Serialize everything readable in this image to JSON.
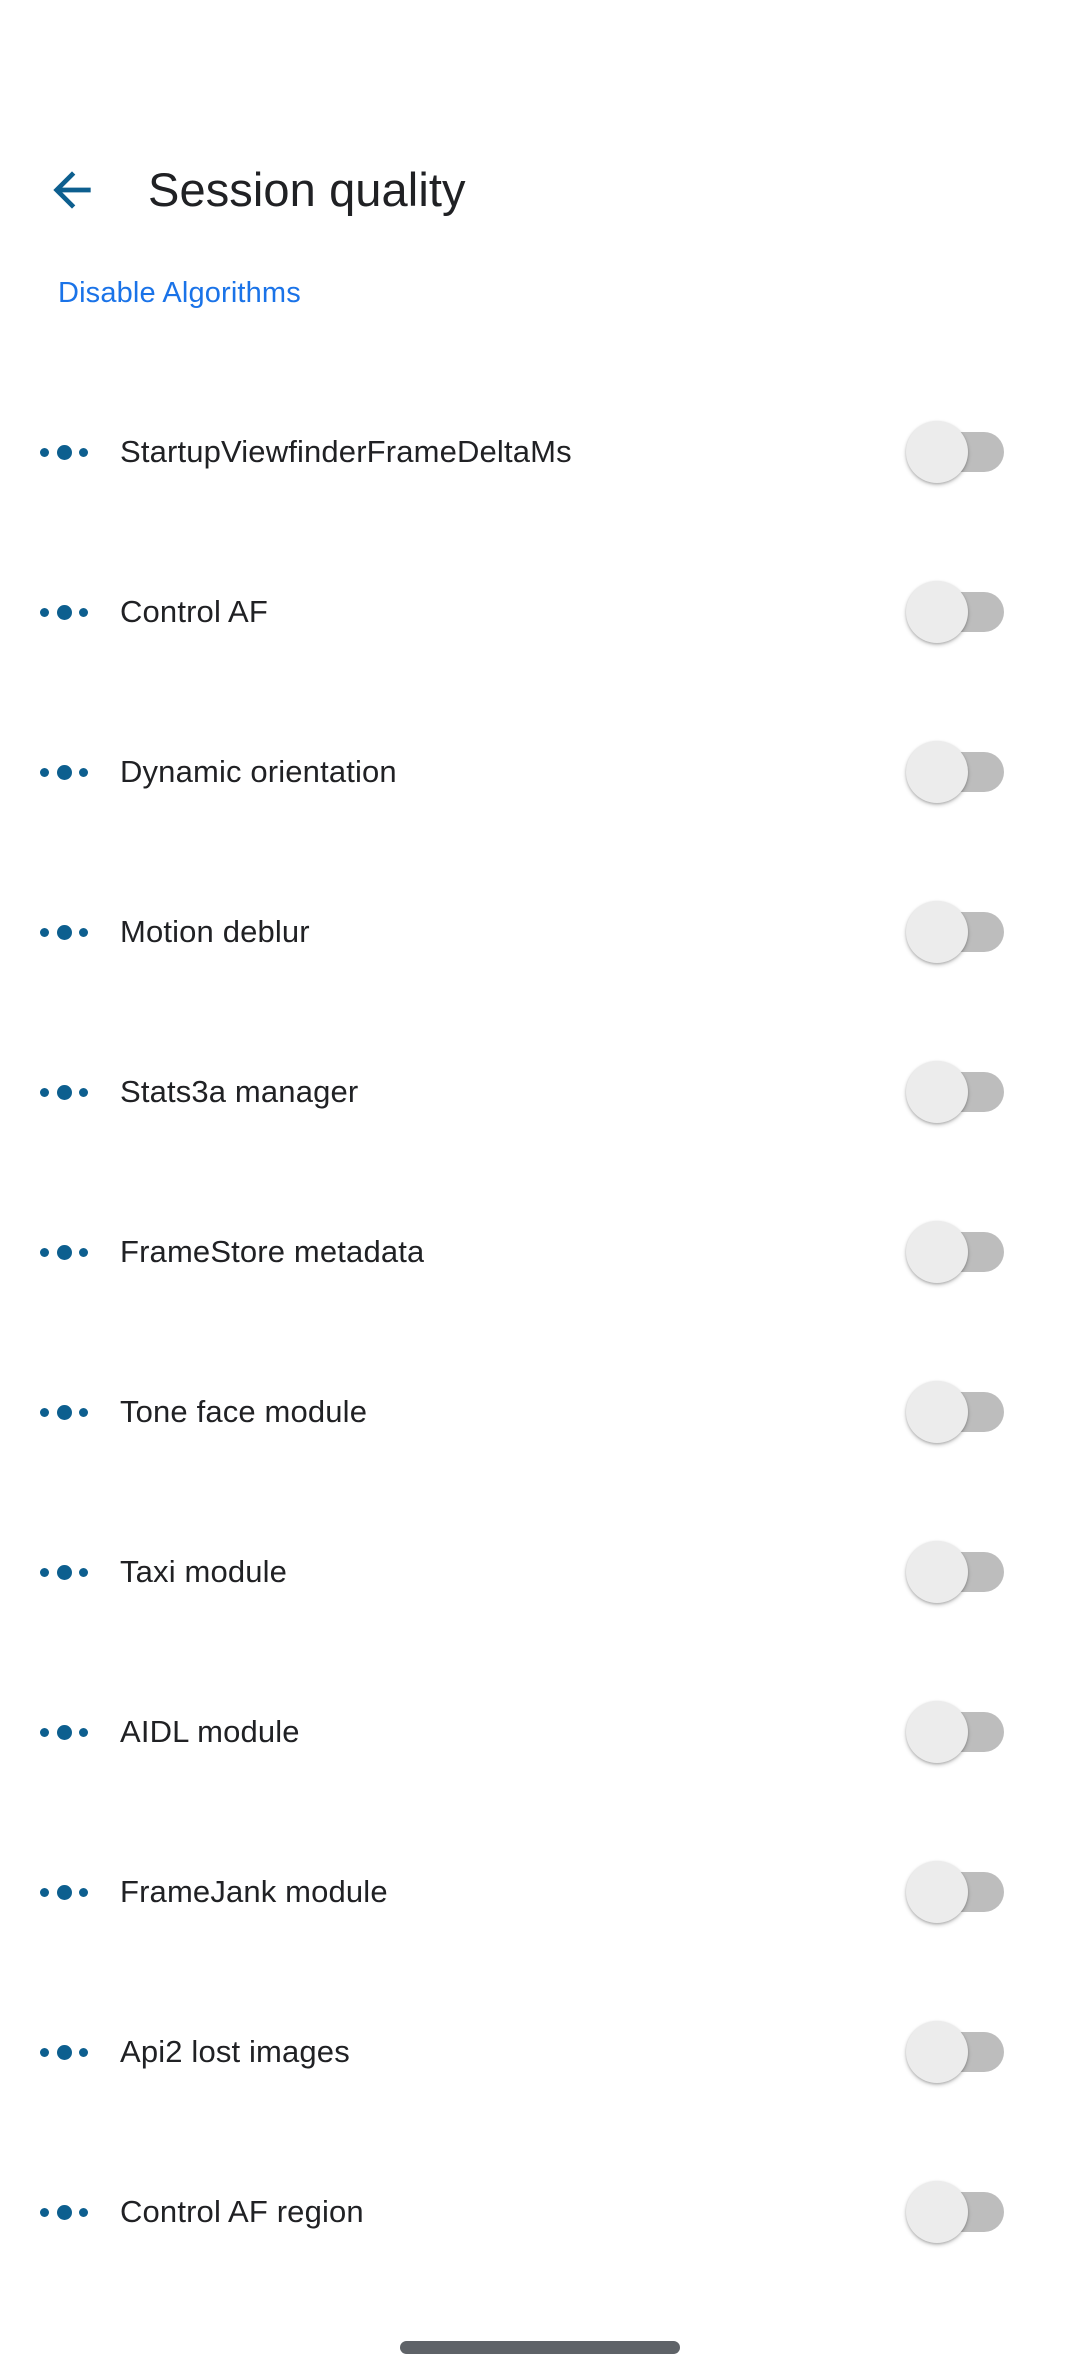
{
  "colors": {
    "accent_blue": "#0d5f8f",
    "link_blue": "#1a73e8",
    "text_primary": "#202124",
    "switch_track_off": "#bdbdbd",
    "switch_thumb_off": "#ececec",
    "gesture_bar": "#5f6368",
    "background": "#ffffff"
  },
  "header": {
    "back_icon": "arrow-left-icon",
    "title": "Session quality"
  },
  "section": {
    "action_link": "Disable Algorithms"
  },
  "list": {
    "bullet_icon": "three-dots-icon",
    "items": [
      {
        "label": "StartupViewfinderFrameDeltaMs",
        "toggle": "off"
      },
      {
        "label": "Control AF",
        "toggle": "off"
      },
      {
        "label": "Dynamic orientation",
        "toggle": "off"
      },
      {
        "label": "Motion deblur",
        "toggle": "off"
      },
      {
        "label": "Stats3a manager",
        "toggle": "off"
      },
      {
        "label": "FrameStore metadata",
        "toggle": "off"
      },
      {
        "label": "Tone face module",
        "toggle": "off"
      },
      {
        "label": "Taxi module",
        "toggle": "off"
      },
      {
        "label": "AIDL module",
        "toggle": "off"
      },
      {
        "label": "FrameJank module",
        "toggle": "off"
      },
      {
        "label": "Api2 lost images",
        "toggle": "off"
      },
      {
        "label": "Control AF region",
        "toggle": "off"
      }
    ]
  },
  "navigation": {
    "gesture_bar": "home-gesture-bar"
  }
}
